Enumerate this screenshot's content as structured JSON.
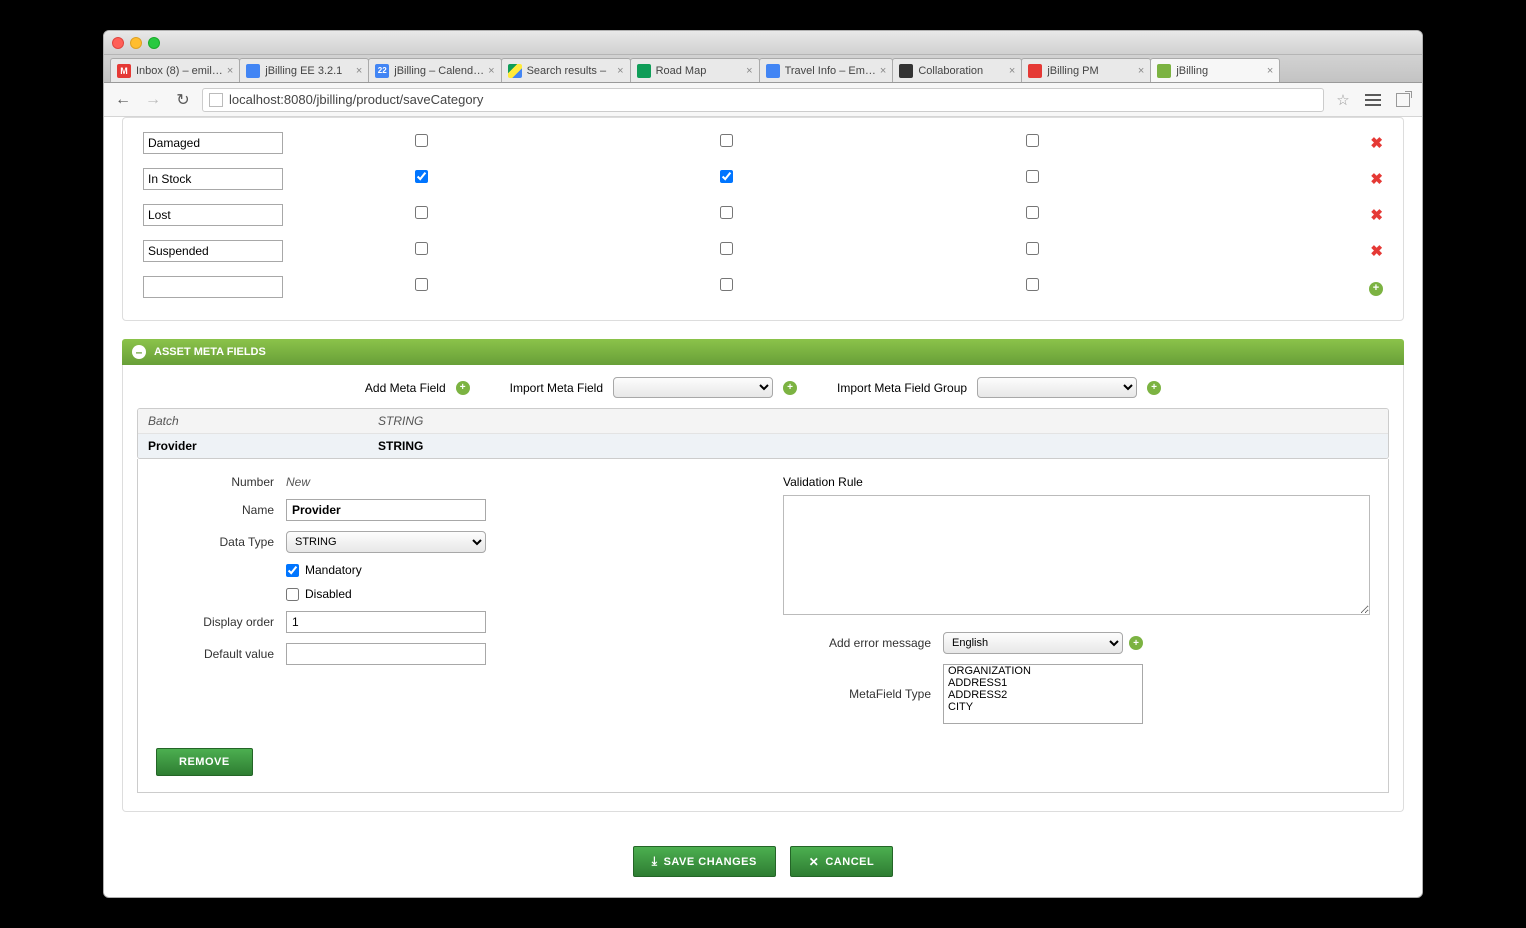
{
  "browser": {
    "url": "localhost:8080/jbilling/product/saveCategory",
    "tabs": [
      {
        "title": "Inbox (8) – emil…",
        "fav": "gmail"
      },
      {
        "title": "jBilling EE 3.2.1",
        "fav": "docs"
      },
      {
        "title": "jBilling – Calend…",
        "fav": "cal",
        "badge": "22"
      },
      {
        "title": "Search results –",
        "fav": "drive"
      },
      {
        "title": "Road Map",
        "fav": "sheets"
      },
      {
        "title": "Travel Info – Em…",
        "fav": "docs"
      },
      {
        "title": "Collaboration",
        "fav": "github"
      },
      {
        "title": "jBilling PM",
        "fav": "pm"
      },
      {
        "title": "jBilling",
        "fav": "jb",
        "active": true
      }
    ]
  },
  "status_rows": [
    {
      "name": "Damaged",
      "c1": false,
      "c2": false,
      "c3": false,
      "action": "x"
    },
    {
      "name": "In Stock",
      "c1": true,
      "c2": true,
      "c3": false,
      "action": "x"
    },
    {
      "name": "Lost",
      "c1": false,
      "c2": false,
      "c3": false,
      "action": "x"
    },
    {
      "name": "Suspended",
      "c1": false,
      "c2": false,
      "c3": false,
      "action": "x"
    },
    {
      "name": "",
      "c1": false,
      "c2": false,
      "c3": false,
      "action": "add"
    }
  ],
  "section": {
    "title": "ASSET META FIELDS"
  },
  "actions": {
    "add_label": "Add Meta Field",
    "import_field_label": "Import Meta Field",
    "import_group_label": "Import Meta Field Group"
  },
  "mf_rows": [
    {
      "name": "Batch",
      "type": "STRING",
      "header": true
    },
    {
      "name": "Provider",
      "type": "STRING",
      "selected": true
    }
  ],
  "detail": {
    "number_label": "Number",
    "number_value": "New",
    "name_label": "Name",
    "name_value": "Provider",
    "datatype_label": "Data Type",
    "datatype_value": "STRING",
    "mandatory_label": "Mandatory",
    "mandatory": true,
    "disabled_label": "Disabled",
    "disabled": false,
    "displayorder_label": "Display order",
    "displayorder_value": "1",
    "default_label": "Default value",
    "default_value": "",
    "validation_label": "Validation Rule",
    "validation_value": "",
    "errmsg_label": "Add error message",
    "errmsg_lang": "English",
    "mftype_label": "MetaField Type",
    "mftype_options": [
      "ORGANIZATION",
      "ADDRESS1",
      "ADDRESS2",
      "CITY"
    ]
  },
  "buttons": {
    "remove": "REMOVE",
    "save": "SAVE CHANGES",
    "cancel": "CANCEL"
  }
}
